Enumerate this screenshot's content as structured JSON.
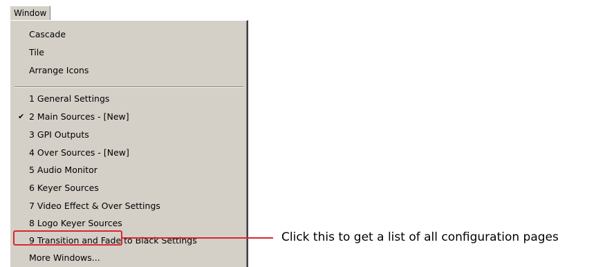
{
  "menubar": {
    "title": "Window"
  },
  "menu": {
    "items": [
      {
        "label": "Cascade",
        "checked": false
      },
      {
        "label": "Tile",
        "checked": false
      },
      {
        "label": "Arrange Icons",
        "checked": false
      },
      {
        "label": "1 General Settings",
        "checked": false
      },
      {
        "label": "2 Main Sources - [New]",
        "checked": true
      },
      {
        "label": "3 GPI Outputs",
        "checked": false
      },
      {
        "label": "4 Over Sources - [New]",
        "checked": false
      },
      {
        "label": "5 Audio Monitor",
        "checked": false
      },
      {
        "label": "6 Keyer Sources",
        "checked": false
      },
      {
        "label": "7 Video Effect & Over Settings",
        "checked": false
      },
      {
        "label": "8 Logo Keyer Sources",
        "checked": false
      },
      {
        "label": "9 Transition and Fade to Black Settings",
        "checked": false
      },
      {
        "label": "More Windows...",
        "checked": false
      }
    ],
    "check_glyph": "✔"
  },
  "annotation": {
    "text": "Click this to get a list of all configuration pages",
    "color": "#d9262e"
  }
}
